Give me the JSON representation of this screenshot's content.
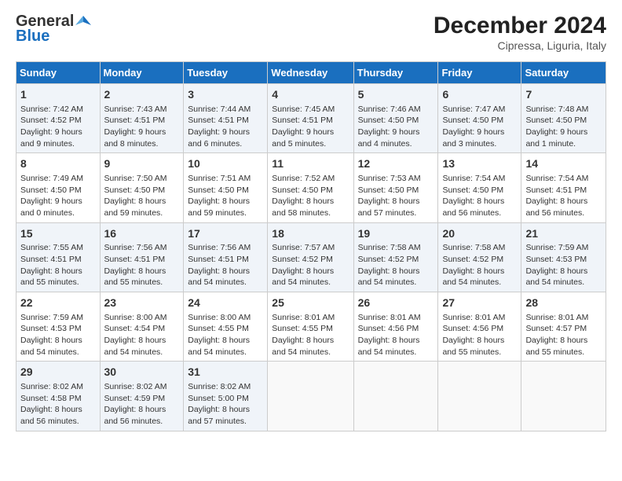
{
  "header": {
    "logo_general": "General",
    "logo_blue": "Blue",
    "title": "December 2024",
    "subtitle": "Cipressa, Liguria, Italy"
  },
  "columns": [
    "Sunday",
    "Monday",
    "Tuesday",
    "Wednesday",
    "Thursday",
    "Friday",
    "Saturday"
  ],
  "weeks": [
    [
      {
        "day": "1",
        "detail": "Sunrise: 7:42 AM\nSunset: 4:52 PM\nDaylight: 9 hours and 9 minutes."
      },
      {
        "day": "2",
        "detail": "Sunrise: 7:43 AM\nSunset: 4:51 PM\nDaylight: 9 hours and 8 minutes."
      },
      {
        "day": "3",
        "detail": "Sunrise: 7:44 AM\nSunset: 4:51 PM\nDaylight: 9 hours and 6 minutes."
      },
      {
        "day": "4",
        "detail": "Sunrise: 7:45 AM\nSunset: 4:51 PM\nDaylight: 9 hours and 5 minutes."
      },
      {
        "day": "5",
        "detail": "Sunrise: 7:46 AM\nSunset: 4:50 PM\nDaylight: 9 hours and 4 minutes."
      },
      {
        "day": "6",
        "detail": "Sunrise: 7:47 AM\nSunset: 4:50 PM\nDaylight: 9 hours and 3 minutes."
      },
      {
        "day": "7",
        "detail": "Sunrise: 7:48 AM\nSunset: 4:50 PM\nDaylight: 9 hours and 1 minute."
      }
    ],
    [
      {
        "day": "8",
        "detail": "Sunrise: 7:49 AM\nSunset: 4:50 PM\nDaylight: 9 hours and 0 minutes."
      },
      {
        "day": "9",
        "detail": "Sunrise: 7:50 AM\nSunset: 4:50 PM\nDaylight: 8 hours and 59 minutes."
      },
      {
        "day": "10",
        "detail": "Sunrise: 7:51 AM\nSunset: 4:50 PM\nDaylight: 8 hours and 59 minutes."
      },
      {
        "day": "11",
        "detail": "Sunrise: 7:52 AM\nSunset: 4:50 PM\nDaylight: 8 hours and 58 minutes."
      },
      {
        "day": "12",
        "detail": "Sunrise: 7:53 AM\nSunset: 4:50 PM\nDaylight: 8 hours and 57 minutes."
      },
      {
        "day": "13",
        "detail": "Sunrise: 7:54 AM\nSunset: 4:50 PM\nDaylight: 8 hours and 56 minutes."
      },
      {
        "day": "14",
        "detail": "Sunrise: 7:54 AM\nSunset: 4:51 PM\nDaylight: 8 hours and 56 minutes."
      }
    ],
    [
      {
        "day": "15",
        "detail": "Sunrise: 7:55 AM\nSunset: 4:51 PM\nDaylight: 8 hours and 55 minutes."
      },
      {
        "day": "16",
        "detail": "Sunrise: 7:56 AM\nSunset: 4:51 PM\nDaylight: 8 hours and 55 minutes."
      },
      {
        "day": "17",
        "detail": "Sunrise: 7:56 AM\nSunset: 4:51 PM\nDaylight: 8 hours and 54 minutes."
      },
      {
        "day": "18",
        "detail": "Sunrise: 7:57 AM\nSunset: 4:52 PM\nDaylight: 8 hours and 54 minutes."
      },
      {
        "day": "19",
        "detail": "Sunrise: 7:58 AM\nSunset: 4:52 PM\nDaylight: 8 hours and 54 minutes."
      },
      {
        "day": "20",
        "detail": "Sunrise: 7:58 AM\nSunset: 4:52 PM\nDaylight: 8 hours and 54 minutes."
      },
      {
        "day": "21",
        "detail": "Sunrise: 7:59 AM\nSunset: 4:53 PM\nDaylight: 8 hours and 54 minutes."
      }
    ],
    [
      {
        "day": "22",
        "detail": "Sunrise: 7:59 AM\nSunset: 4:53 PM\nDaylight: 8 hours and 54 minutes."
      },
      {
        "day": "23",
        "detail": "Sunrise: 8:00 AM\nSunset: 4:54 PM\nDaylight: 8 hours and 54 minutes."
      },
      {
        "day": "24",
        "detail": "Sunrise: 8:00 AM\nSunset: 4:55 PM\nDaylight: 8 hours and 54 minutes."
      },
      {
        "day": "25",
        "detail": "Sunrise: 8:01 AM\nSunset: 4:55 PM\nDaylight: 8 hours and 54 minutes."
      },
      {
        "day": "26",
        "detail": "Sunrise: 8:01 AM\nSunset: 4:56 PM\nDaylight: 8 hours and 54 minutes."
      },
      {
        "day": "27",
        "detail": "Sunrise: 8:01 AM\nSunset: 4:56 PM\nDaylight: 8 hours and 55 minutes."
      },
      {
        "day": "28",
        "detail": "Sunrise: 8:01 AM\nSunset: 4:57 PM\nDaylight: 8 hours and 55 minutes."
      }
    ],
    [
      {
        "day": "29",
        "detail": "Sunrise: 8:02 AM\nSunset: 4:58 PM\nDaylight: 8 hours and 56 minutes."
      },
      {
        "day": "30",
        "detail": "Sunrise: 8:02 AM\nSunset: 4:59 PM\nDaylight: 8 hours and 56 minutes."
      },
      {
        "day": "31",
        "detail": "Sunrise: 8:02 AM\nSunset: 5:00 PM\nDaylight: 8 hours and 57 minutes."
      },
      {
        "day": "",
        "detail": ""
      },
      {
        "day": "",
        "detail": ""
      },
      {
        "day": "",
        "detail": ""
      },
      {
        "day": "",
        "detail": ""
      }
    ]
  ]
}
